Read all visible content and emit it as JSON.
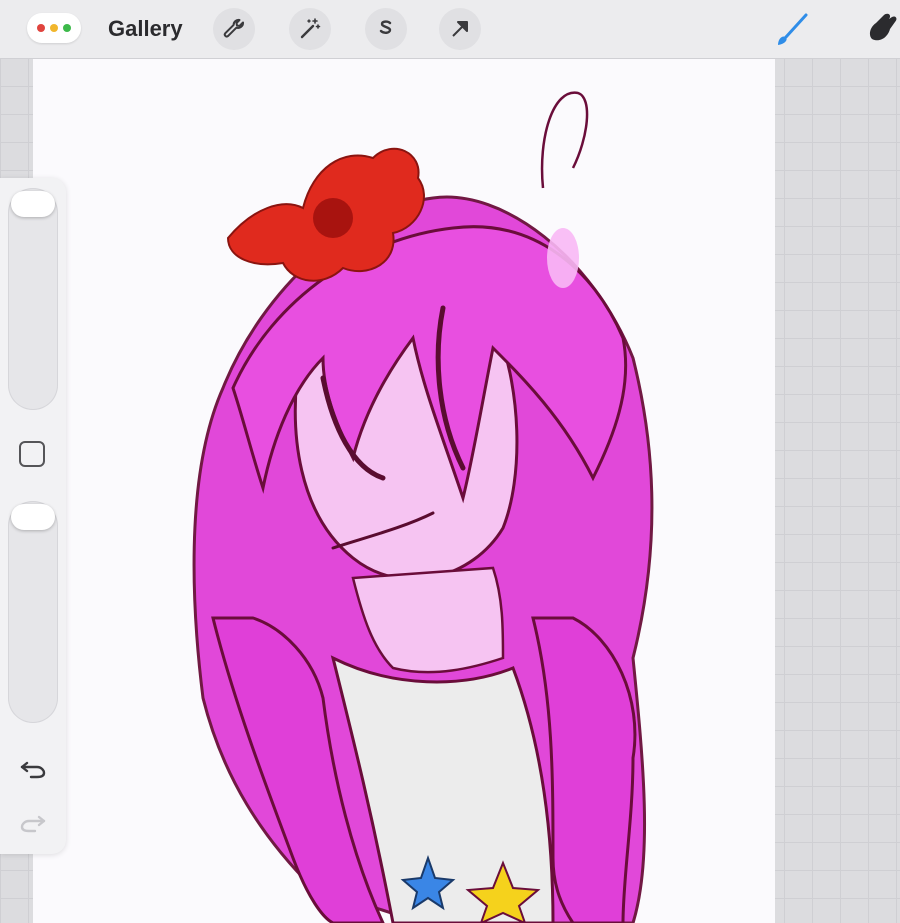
{
  "app": {
    "title": "Gallery",
    "menu_dots_colors": [
      "#e0443e",
      "#f1b62d",
      "#3cb94a"
    ]
  },
  "toolbar": {
    "left_tools": [
      {
        "icon": "wrench-icon",
        "name": "actions"
      },
      {
        "icon": "magic-wand-icon",
        "name": "adjustments"
      },
      {
        "icon": "selection-s-icon",
        "name": "selection"
      },
      {
        "icon": "arrow-cursor-icon",
        "name": "transform"
      }
    ],
    "right_tools": [
      {
        "icon": "brush-icon",
        "name": "paint",
        "active": true,
        "color": "#2f8de8"
      },
      {
        "icon": "smudge-icon",
        "name": "smudge",
        "active": false
      }
    ]
  },
  "sidebar": {
    "brush_size_slider": {
      "level": 0.0
    },
    "modify_button_icon": "square-icon",
    "opacity_slider": {
      "level": 0.0
    },
    "undo_icon": "undo-icon",
    "redo_icon": "redo-icon"
  },
  "canvas": {
    "background": "#fbfafd",
    "artwork": "pink-haired-character-sketch",
    "palette": {
      "hair": "#e03fd8",
      "flower": "#e02a1e",
      "line": "#6a0d3a",
      "star": "#f5d21c",
      "star2": "#3a86e6"
    }
  }
}
